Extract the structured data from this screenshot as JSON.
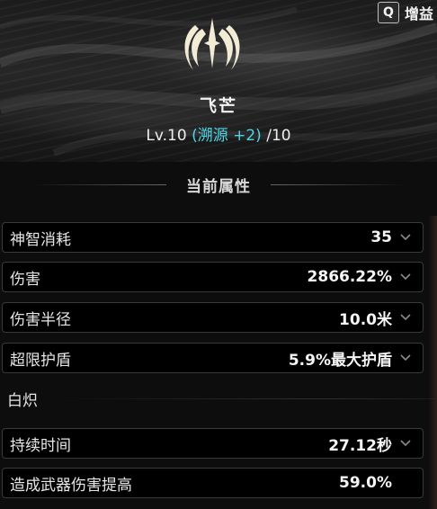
{
  "buff": {
    "key": "Q",
    "label": "增益"
  },
  "skill": {
    "name": "飞芒",
    "level_prefix": "Lv.10",
    "level_bonus": "(溯源 +2)",
    "level_max": "/10"
  },
  "section_title": "当前属性",
  "stats": [
    {
      "label": "神智消耗",
      "value": "35",
      "expandable": true
    },
    {
      "label": "伤害",
      "value": "2866.22%",
      "expandable": true
    },
    {
      "label": "伤害半径",
      "value": "10.0米",
      "expandable": true
    },
    {
      "label": "超限护盾",
      "value": "5.9%最大护盾",
      "expandable": true
    }
  ],
  "group": {
    "label": "白炽",
    "stats": [
      {
        "label": "持续时间",
        "value": "27.12秒",
        "expandable": true
      },
      {
        "label": "造成武器伤害提高",
        "value": "59.0%",
        "expandable": false
      }
    ]
  },
  "colors": {
    "accent": "#4fd6e6",
    "emblem": "#f2ecd6"
  },
  "icons": {
    "emblem": "radiant-star-emblem-icon",
    "chevron": "chevron-down-icon"
  }
}
